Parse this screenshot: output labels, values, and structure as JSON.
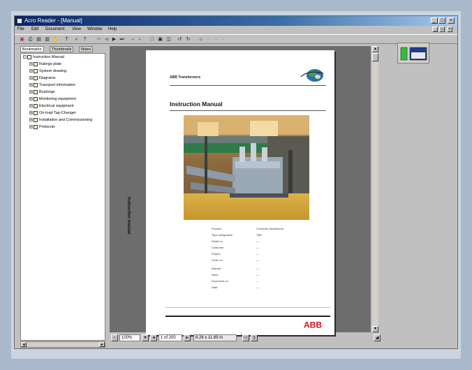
{
  "window": {
    "title": "Acro Reader - [Manual]",
    "controls": [
      "_",
      "□",
      "×"
    ],
    "mdi_controls": [
      "_",
      "□",
      "×"
    ]
  },
  "menu": [
    "File",
    "Edit",
    "Document",
    "View",
    "Window",
    "Help"
  ],
  "toolbar": {
    "icons": [
      "open-icon",
      "print-icon",
      "save-icon",
      "email-icon",
      "hand-icon",
      "zoom-in-icon",
      "select-text-icon",
      "first-page-icon",
      "previous-page-icon",
      "next-page-icon",
      "last-page-icon",
      "go-back-icon",
      "go-forward-icon",
      "actual-size-icon",
      "fit-page-icon",
      "fit-width-icon",
      "rotate-left-icon",
      "rotate-right-icon",
      "find-icon",
      "web-search-icon"
    ]
  },
  "sidebar": {
    "tabs": [
      "Bookmarks",
      "Thumbnails",
      "Notes"
    ],
    "root": "Instruction Manual",
    "items": [
      {
        "label": "Ratings plate"
      },
      {
        "label": "System drawing"
      },
      {
        "label": "Diagrams"
      },
      {
        "label": "Transport information"
      },
      {
        "label": "Bushings"
      },
      {
        "label": "Monitoring equipment"
      },
      {
        "label": "Electrical equipment"
      },
      {
        "label": "On-load Tap-Changer"
      },
      {
        "label": "Installation and Commissioning"
      },
      {
        "label": "Protocols"
      }
    ]
  },
  "document": {
    "company": "ABB Transformers",
    "title": "Instruction Manual",
    "side_text": "Instruction manual",
    "fields": [
      {
        "label": "Product",
        "value": "Converter transformer"
      },
      {
        "label": "Type designation",
        "value": "TBD"
      },
      {
        "label": "Serial no",
        "value": "—"
      },
      {
        "label": "Customer",
        "value": "—"
      },
      {
        "label": "Project",
        "value": "—"
      },
      {
        "label": "Order no",
        "value": "—"
      },
      {
        "label": "Manual",
        "value": "—"
      },
      {
        "label": "Issue",
        "value": "—"
      },
      {
        "label": "Document no",
        "value": "—"
      },
      {
        "label": "Date",
        "value": "—"
      }
    ],
    "logo": "ABB",
    "page_number": "1"
  },
  "status": {
    "zoom": "100%",
    "page": "1 of 200",
    "page_size": "8.26 x 11.69 in"
  },
  "colors": {
    "abb_red": "#d2121a",
    "title_blue": "#0a246a"
  }
}
